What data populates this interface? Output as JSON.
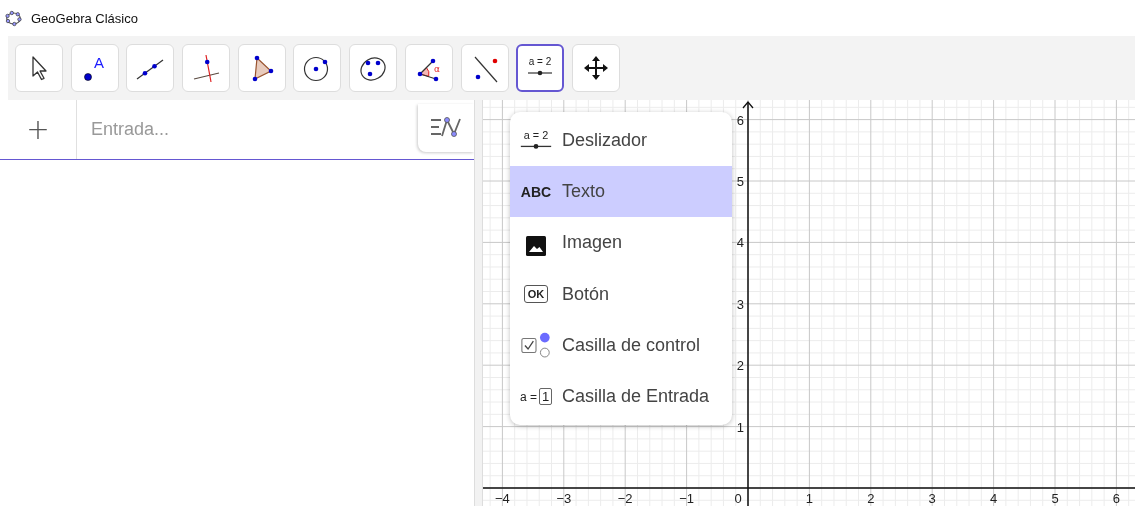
{
  "window": {
    "title": "GeoGebra Clásico"
  },
  "toolbar": {
    "tools": [
      {
        "kind": "move",
        "selected": false
      },
      {
        "kind": "point",
        "icon_text": "A",
        "selected": false
      },
      {
        "kind": "line",
        "selected": false
      },
      {
        "kind": "perpendicular",
        "selected": false
      },
      {
        "kind": "polygon",
        "selected": false
      },
      {
        "kind": "circle",
        "selected": false
      },
      {
        "kind": "conic",
        "selected": false
      },
      {
        "kind": "angle",
        "icon_text": "α",
        "selected": false
      },
      {
        "kind": "reflect",
        "selected": false
      },
      {
        "kind": "slider",
        "icon_text": "a = 2",
        "selected": true
      },
      {
        "kind": "move-view",
        "selected": false
      }
    ]
  },
  "algebra": {
    "add_button": "+",
    "input": {
      "placeholder": "Entrada..."
    }
  },
  "graphics": {
    "x_labels": [
      "−4",
      "−3",
      "−2",
      "−1",
      "0",
      "1",
      "2",
      "3",
      "4",
      "5",
      "6"
    ],
    "y_labels": [
      "6",
      "5",
      "4",
      "3",
      "2",
      "1"
    ]
  },
  "menu": {
    "items": [
      {
        "kind": "slider",
        "icon_text": "a = 2",
        "label": "Deslizador",
        "selected": false
      },
      {
        "kind": "text",
        "icon_text": "ABC",
        "label": "Texto",
        "selected": true
      },
      {
        "kind": "image",
        "label": "Imagen",
        "selected": false
      },
      {
        "kind": "button",
        "icon_text": "OK",
        "label": "Botón",
        "selected": false
      },
      {
        "kind": "checkbox",
        "label": "Casilla de control",
        "selected": false
      },
      {
        "kind": "input",
        "icon_text": "a =",
        "icon_value": "1",
        "label": "Casilla de Entrada",
        "selected": false
      }
    ]
  }
}
